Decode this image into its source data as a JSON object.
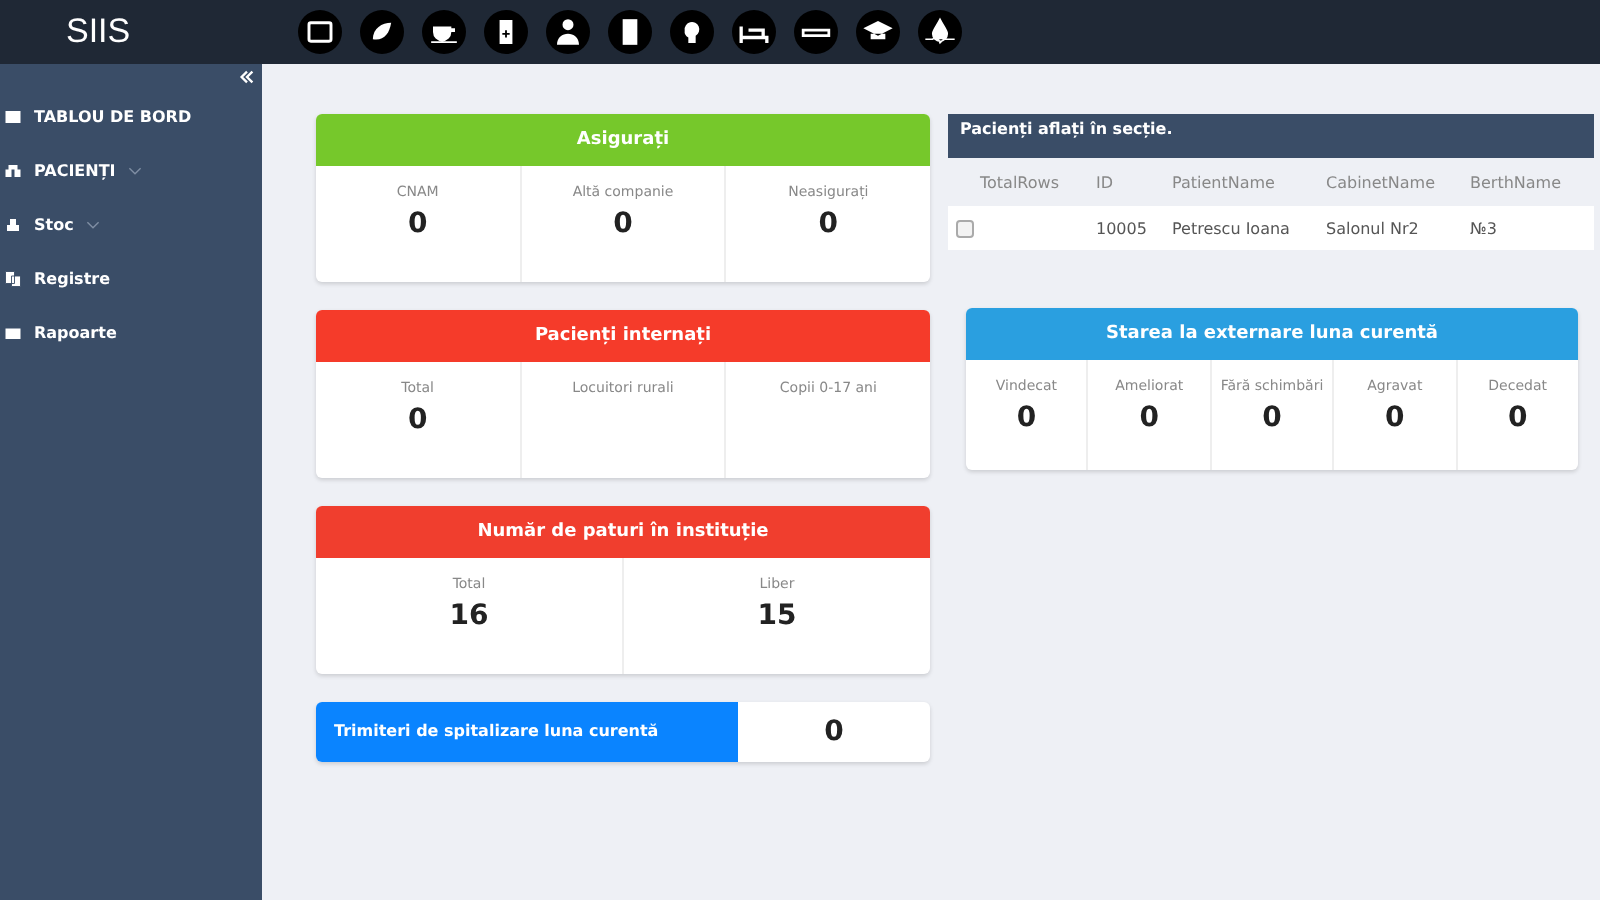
{
  "header": {
    "logo": "SIIS"
  },
  "sidebar": {
    "items": [
      {
        "label": "TABLOU DE BORD",
        "expandable": false
      },
      {
        "label": "PACIENȚI",
        "expandable": true
      },
      {
        "label": "Stoc",
        "expandable": true
      },
      {
        "label": "Registre",
        "expandable": false
      },
      {
        "label": "Rapoarte",
        "expandable": false
      }
    ]
  },
  "left_cards": [
    {
      "kind": "stats",
      "title": "Asigurați",
      "color": "#76c82b",
      "stats": [
        {
          "label": "CNAM",
          "value": "0"
        },
        {
          "label": "Altă companie",
          "value": "0"
        },
        {
          "label": "Neasigurați",
          "value": "0"
        }
      ]
    },
    {
      "kind": "stats",
      "title": "Pacienți internați",
      "color": "#f53b2a",
      "stats": [
        {
          "label": "Total",
          "value": "0"
        },
        {
          "label": "Locuitori rurali"
        },
        {
          "label": "Copii 0-17 ani"
        }
      ]
    },
    {
      "kind": "stats",
      "title": "Număr de paturi în instituție",
      "color": "#f03e2e",
      "stats": [
        {
          "label": "Total",
          "value": "16"
        },
        {
          "label": "Liber",
          "value": "15"
        }
      ]
    },
    {
      "kind": "inline",
      "title": "Trimiteri de spitalizare luna curentă",
      "color": "#0a84ff",
      "value": "0"
    }
  ],
  "patients_panel": {
    "title": "Pacienți aflați în secție.",
    "columns": [
      "TotalRows",
      "ID",
      "PatientName",
      "CabinetName",
      "BerthName"
    ],
    "rows": [
      {
        "checked": false,
        "id": "10005",
        "patient": "Petrescu Ioana",
        "cabinet": "Salonul Nr2",
        "berth": "№3"
      }
    ]
  },
  "discharge_card": {
    "kind": "stats",
    "title": "Starea la externare luna curentă",
    "color": "#2a9fe0",
    "stats": [
      {
        "label": "Vindecat",
        "value": "0"
      },
      {
        "label": "Ameliorat",
        "value": "0"
      },
      {
        "label": "Fără schimbări",
        "value": "0"
      },
      {
        "label": "Agravat",
        "value": "0"
      },
      {
        "label": "Decedat",
        "value": "0"
      }
    ]
  }
}
